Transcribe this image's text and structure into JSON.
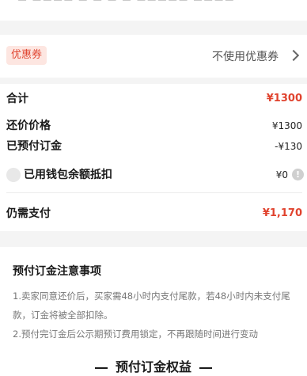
{
  "coupon": {
    "tag": "优惠券",
    "value": "不使用优惠券"
  },
  "summary": {
    "total_label": "合计",
    "total_value": "¥1300",
    "counter_label": "还价价格",
    "counter_value": "¥1300",
    "deposit_label": "已预付订金",
    "deposit_value": "-¥130",
    "wallet_label": "已用钱包余额抵扣",
    "wallet_value": "¥0",
    "due_label": "仍需支付",
    "due_value": "¥1,170"
  },
  "notes": {
    "title": "预付订金注意事项",
    "line1": "1.卖家同意还价后，买家需48小时内支付尾款，若48小时内未支付尾款，订金将被全部扣除。",
    "line2": "2.预付完订金后公示期预订费用锁定，不再跟随时间进行变动"
  },
  "benefits_title": "预付订金权益",
  "colors": {
    "accent": "#e0432e",
    "coupon_bg": "#fde6e1"
  }
}
